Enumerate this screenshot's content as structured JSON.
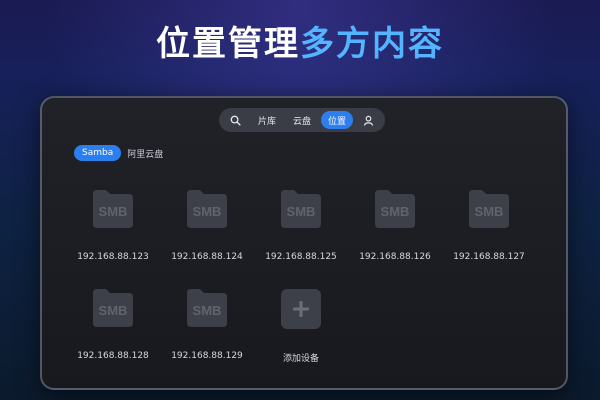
{
  "headline": {
    "part1": "位置管理",
    "part2": "多方内容"
  },
  "topbar": {
    "items": [
      {
        "label": "片库"
      },
      {
        "label": "云盘"
      },
      {
        "label": "位置",
        "active": true
      }
    ]
  },
  "source_tabs": {
    "active": "Samba",
    "other": "阿里云盘"
  },
  "devices": [
    {
      "name": "192.168.88.123",
      "badge": "SMB"
    },
    {
      "name": "192.168.88.124",
      "badge": "SMB"
    },
    {
      "name": "192.168.88.125",
      "badge": "SMB"
    },
    {
      "name": "192.168.88.126",
      "badge": "SMB"
    },
    {
      "name": "192.168.88.127",
      "badge": "SMB"
    },
    {
      "name": "192.168.88.128",
      "badge": "SMB"
    },
    {
      "name": "192.168.88.129",
      "badge": "SMB"
    }
  ],
  "add_device": {
    "label": "添加设备"
  },
  "colors": {
    "accent": "#2d7ff0",
    "headline_highlight": "#53b4ff",
    "folder": "#3d4049"
  }
}
